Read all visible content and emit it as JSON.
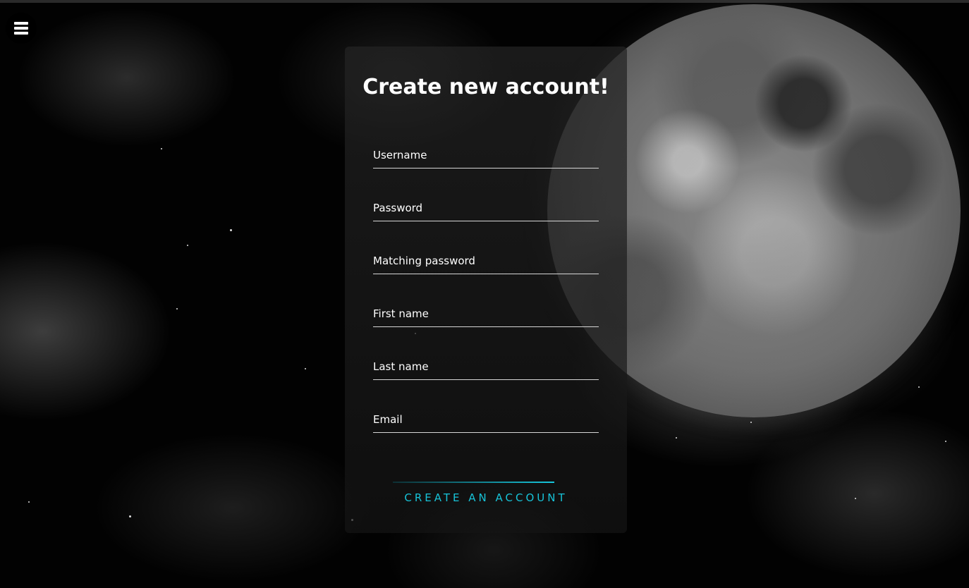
{
  "page": {
    "title": "Create new account!"
  },
  "menu": {
    "icon": "hamburger-menu-icon"
  },
  "form": {
    "fields": [
      {
        "label": "Username",
        "value": ""
      },
      {
        "label": "Password",
        "value": ""
      },
      {
        "label": "Matching password",
        "value": ""
      },
      {
        "label": "First name",
        "value": ""
      },
      {
        "label": "Last name",
        "value": ""
      },
      {
        "label": "Email",
        "value": ""
      }
    ],
    "submit_label": "CREATE AN ACCOUNT"
  },
  "colors": {
    "accent": "#17c3d8",
    "text": "#ffffff",
    "background": "#000000"
  }
}
